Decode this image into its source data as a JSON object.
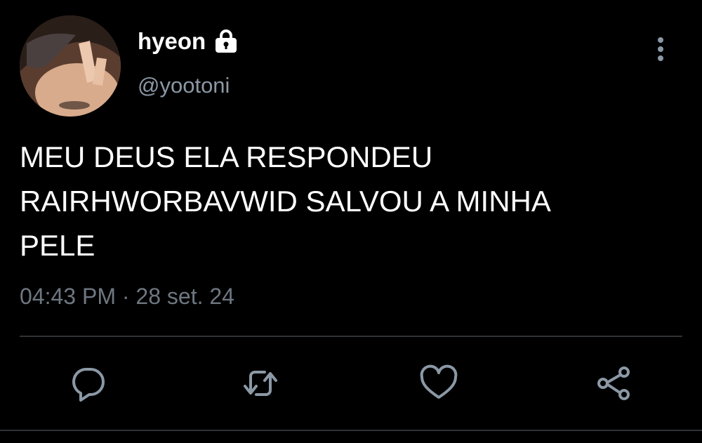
{
  "user": {
    "display_name": "hyeon",
    "handle": "@yootoni",
    "protected_icon": "lock-icon",
    "avatar_icon": "profile-photo"
  },
  "tweet": {
    "text": "MEU DEUS ELA RESPONDEU\nRAIRHWORBAVWID SALVOU A MINHA\nPELE",
    "timestamp": "04:43 PM · 28 set. 24"
  },
  "actions": {
    "reply_icon": "reply-icon",
    "retweet_icon": "retweet-icon",
    "like_icon": "heart-icon",
    "share_icon": "share-icon",
    "more_icon": "more-vertical-icon"
  },
  "colors": {
    "background": "#000000",
    "primary_text": "#ffffff",
    "secondary_text": "#8b98a5",
    "icon": "#8b98a5",
    "divider": "#2f3336"
  }
}
